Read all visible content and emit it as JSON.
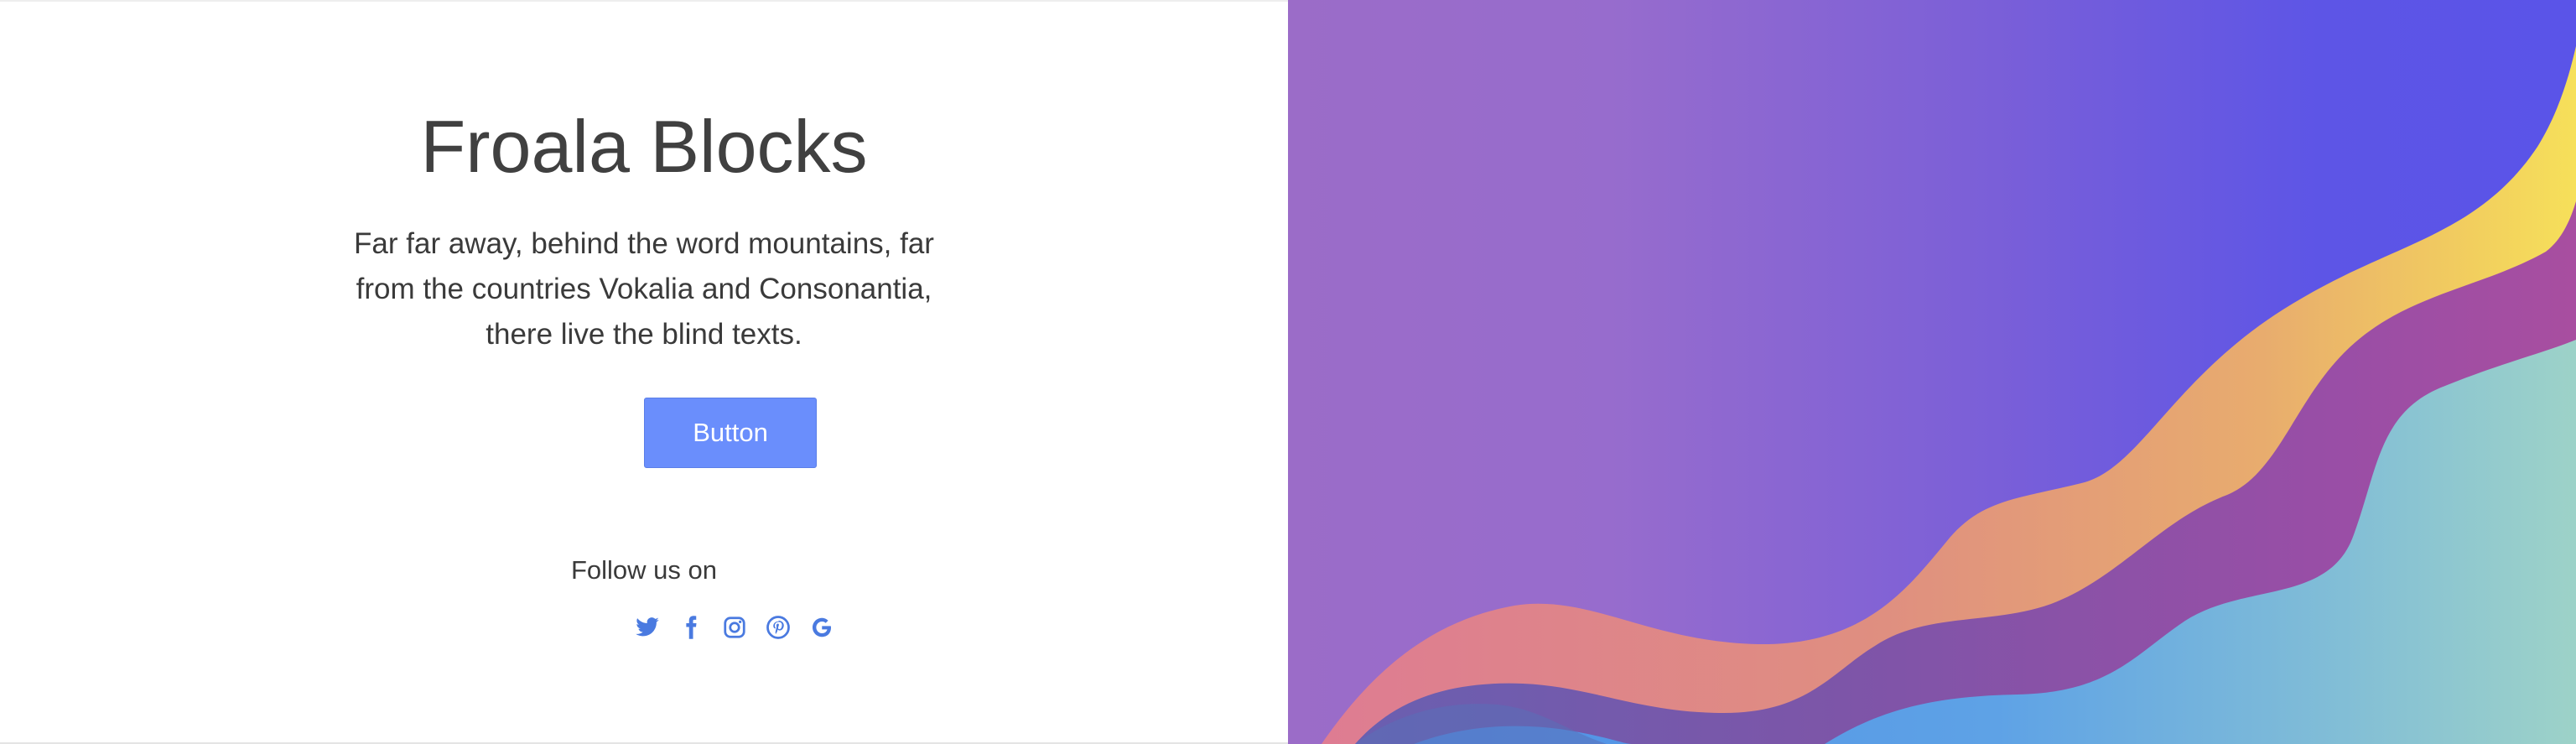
{
  "hero": {
    "title": "Froala Blocks",
    "description": "Far far away, behind the word mountains, far from the countries Vokalia and Consonantia, there live the blind texts.",
    "button_label": "Button",
    "follow_label": "Follow us on"
  },
  "social": [
    {
      "name": "twitter-icon"
    },
    {
      "name": "facebook-icon"
    },
    {
      "name": "instagram-icon"
    },
    {
      "name": "pinterest-icon"
    },
    {
      "name": "google-icon"
    }
  ],
  "colors": {
    "button": "#6a8efc",
    "icon": "#4a7ae0",
    "text": "#404040",
    "bg_purple_left": "#9b6cc8",
    "bg_purple_right": "#5d55e6",
    "wave_pink": "#e0808f",
    "wave_yellow": "#f6df58",
    "wave_magenta": "#9a4ea8",
    "wave_blue": "#5ea2e6",
    "wave_teal": "#9cd0c8"
  }
}
